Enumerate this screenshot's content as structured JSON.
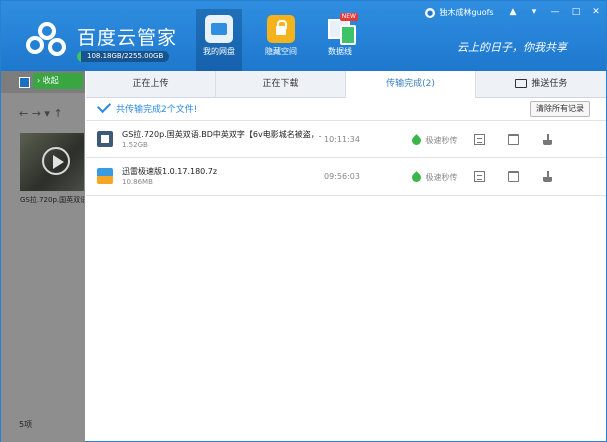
{
  "app": {
    "title": "百度云管家",
    "quota_text": "108.18GB/2255.00GB",
    "quota_used_fraction": 0.048,
    "slogan": "云上的日子，你我共享"
  },
  "nav": [
    {
      "label": "我的网盘",
      "icon": "disk-icon",
      "active": true
    },
    {
      "label": "隐藏空间",
      "icon": "lock-icon",
      "active": false
    },
    {
      "label": "数据线",
      "icon": "data-cable-icon",
      "active": false,
      "badge": "NEW"
    }
  ],
  "user": {
    "name": "独木成林guofs"
  },
  "window_controls": [
    "▲",
    "▾",
    "—",
    "□",
    "✕"
  ],
  "left_panel": {
    "collapse_label": "收起",
    "nav_arrows": "← → ▾ ↑",
    "thumbnail_name": "GS拉.720p.国英双语",
    "item_count": "5项"
  },
  "tabs": {
    "uploading": "正在上传",
    "downloading": "正在下载",
    "completed": "传输完成(2)",
    "push": "推送任务"
  },
  "summary": {
    "text": "共传输完成2个文件!",
    "clear_label": "清除所有记录"
  },
  "files": [
    {
      "name": "GS拉.720p.国英双语.BD中英双字【6v电影城名被盗，...",
      "size": "1.52GB",
      "time": "10:11:34",
      "speed": "极速秒传",
      "icon": "video-file-icon"
    },
    {
      "name": "迅雷极速版1.0.17.180.7z",
      "size": "10.86MB",
      "time": "09:56:03",
      "speed": "极速秒传",
      "icon": "archive-file-icon"
    }
  ]
}
